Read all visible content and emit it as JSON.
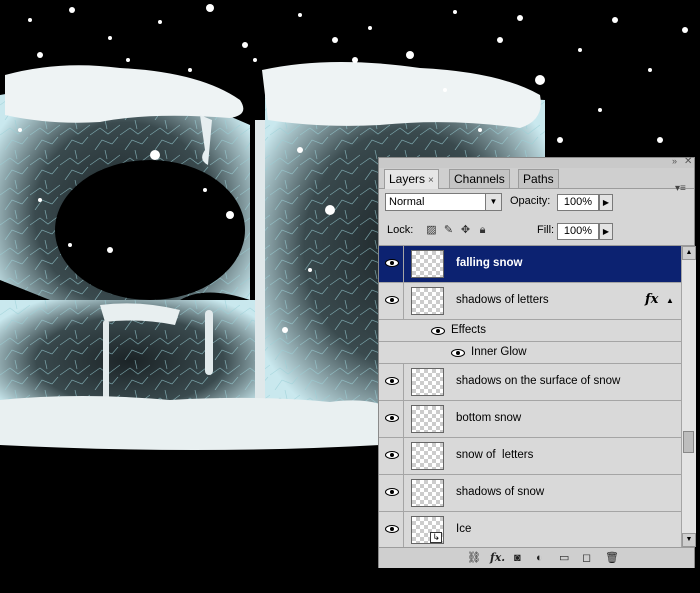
{
  "panel": {
    "tabs": [
      {
        "label": "Layers",
        "active": true
      },
      {
        "label": "Channels",
        "active": false
      },
      {
        "label": "Paths",
        "active": false
      }
    ],
    "blend_mode": "Normal",
    "opacity_label": "Opacity:",
    "opacity_value": "100%",
    "lock_label": "Lock:",
    "fill_label": "Fill:",
    "fill_value": "100%",
    "layers": [
      {
        "name": "falling snow",
        "selected": true
      },
      {
        "name": "shadows of letters",
        "fx": "fx"
      },
      {
        "name": "shadows on the surface of snow"
      },
      {
        "name": "bottom snow"
      },
      {
        "name": "snow of  letters"
      },
      {
        "name": "shadows of snow"
      },
      {
        "name": "Ice"
      }
    ],
    "effects_label": "Effects",
    "inner_glow_label": "Inner Glow",
    "bottom_fx": "fx."
  },
  "colors": {
    "selected_row": "#0c2271",
    "panel_bg": "#d6d6d6",
    "canvas_bg": "#000000"
  }
}
